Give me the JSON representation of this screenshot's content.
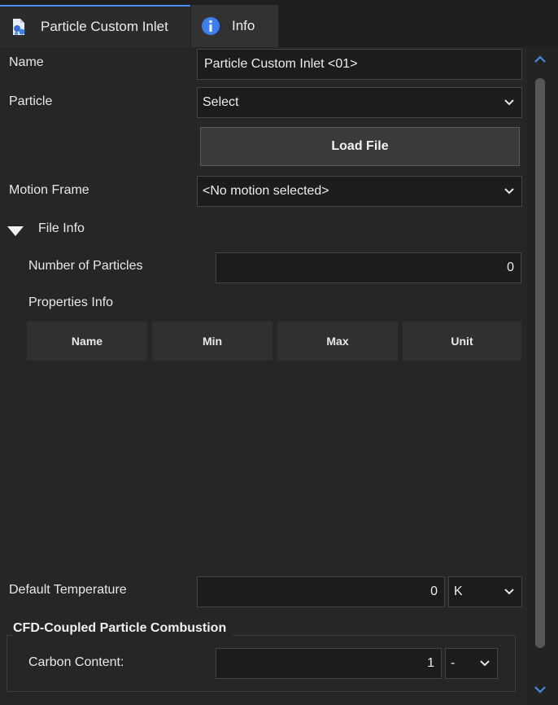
{
  "tabs": [
    {
      "label": "Particle Custom Inlet",
      "icon": "particle-inlet-icon",
      "active": true
    },
    {
      "label": "Info",
      "icon": "info-icon",
      "active": false
    }
  ],
  "form": {
    "name_label": "Name",
    "name_value": "Particle Custom Inlet <01>",
    "particle_label": "Particle",
    "particle_value": "Select",
    "load_file_label": "Load File",
    "motion_frame_label": "Motion Frame",
    "motion_frame_value": "<No motion selected>"
  },
  "file_info": {
    "header": "File Info",
    "num_particles_label": "Number of Particles",
    "num_particles_value": "0",
    "properties_label": "Properties Info",
    "columns": [
      "Name",
      "Min",
      "Max",
      "Unit"
    ]
  },
  "temperature": {
    "label": "Default Temperature",
    "value": "0",
    "unit": "K"
  },
  "combustion": {
    "title": "CFD-Coupled Particle Combustion",
    "carbon_label": "Carbon Content:",
    "carbon_value": "1",
    "carbon_unit": "-"
  },
  "colors": {
    "accent": "#4a8ff0",
    "background": "#262626",
    "field": "#1c1c1c"
  }
}
